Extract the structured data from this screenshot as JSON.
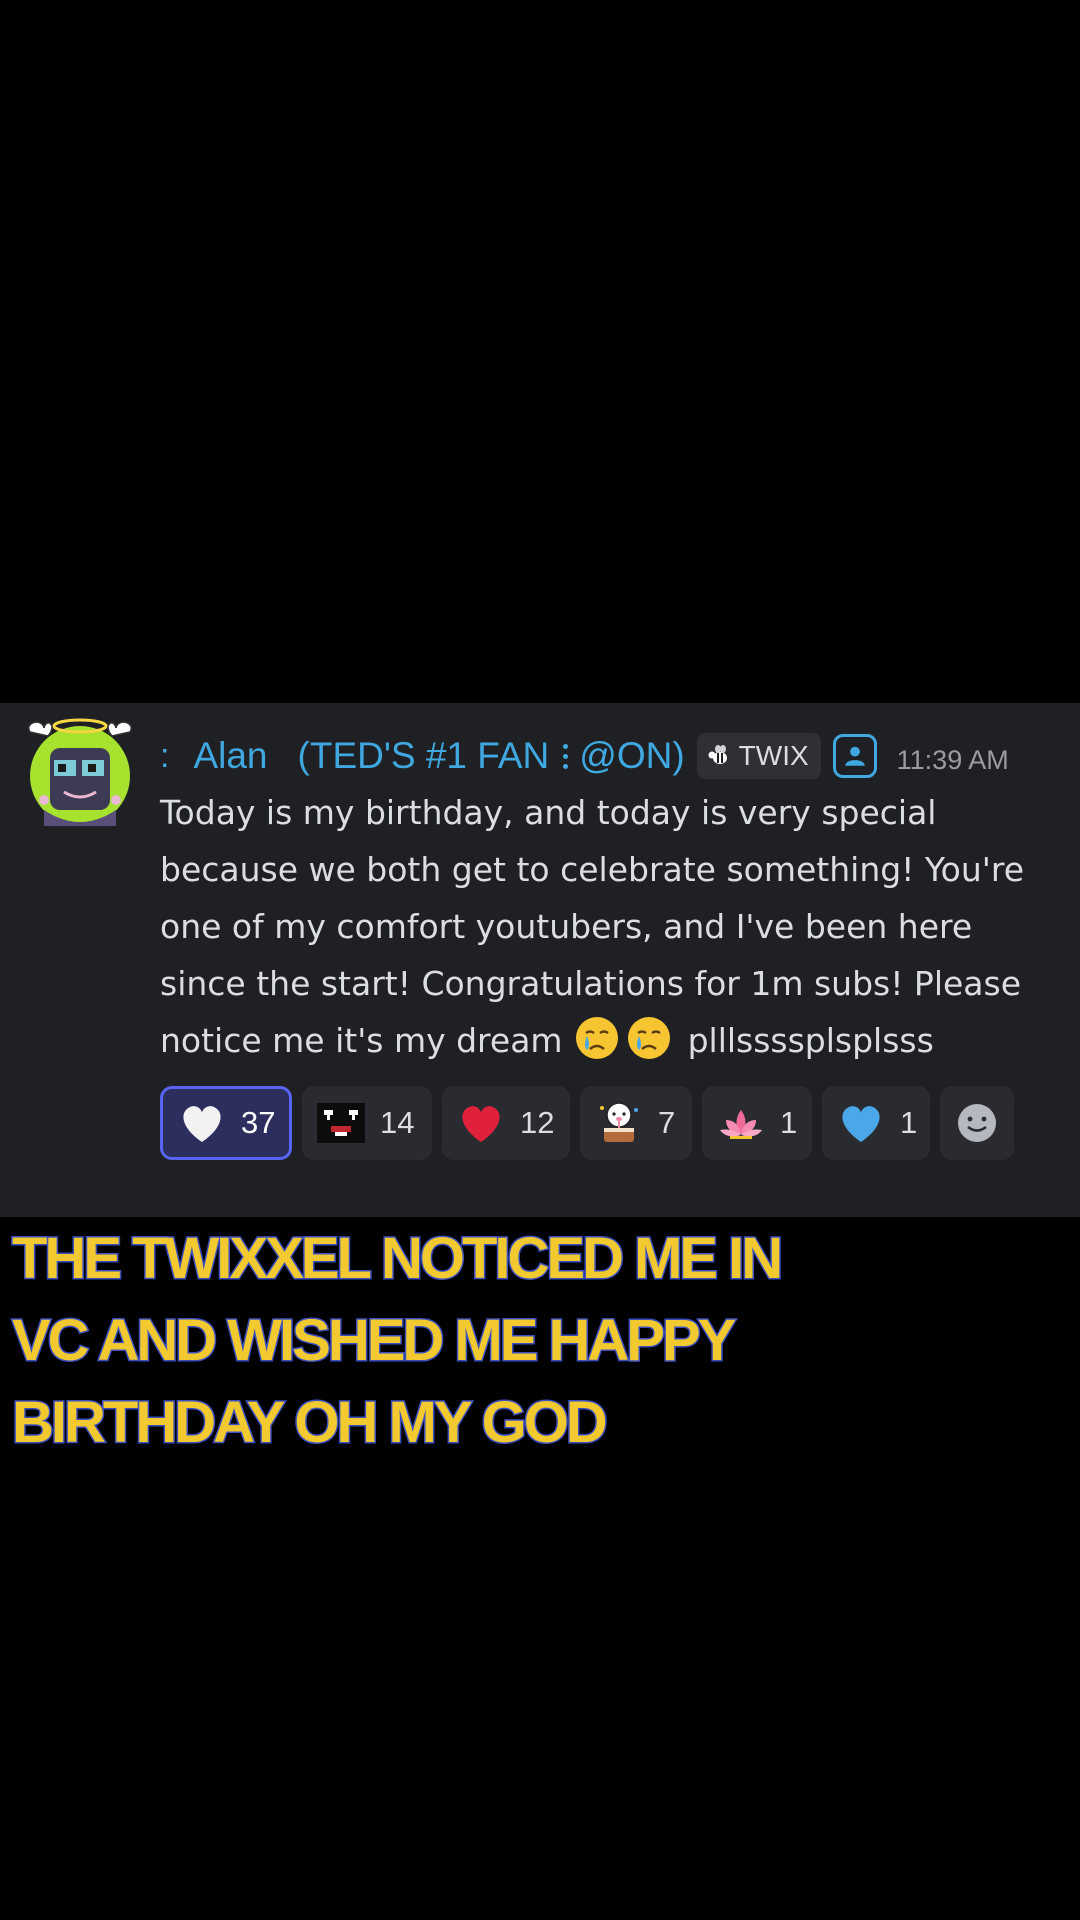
{
  "message": {
    "author": {
      "prefix": ":",
      "name": "Alan",
      "tag": "(TED'S #1 FAN",
      "tag2": "@ON)",
      "guild_tag": "TWIX",
      "name_color": "#3fa8e0"
    },
    "timestamp": "11:39 AM",
    "lines": [
      "Today is my birthday, and today is very special",
      "because we both get to celebrate something! You're",
      "one of my comfort youtubers, and I've been here",
      "since the start! Congratulations for 1m subs! Please"
    ],
    "last_line_prefix": "notice me it's my dream",
    "last_line_suffix": "plllssssplsplsss",
    "last_line_emojis": [
      "crying-face-emoji",
      "crying-face-emoji"
    ]
  },
  "reactions": [
    {
      "emoji": "white-heart",
      "count": "37",
      "active": true
    },
    {
      "emoji": "pixel-face",
      "count": "14",
      "active": false
    },
    {
      "emoji": "red-heart",
      "count": "12",
      "active": false
    },
    {
      "emoji": "birthday-cake-character",
      "count": "7",
      "active": false
    },
    {
      "emoji": "lotus",
      "count": "1",
      "active": false
    },
    {
      "emoji": "blue-heart",
      "count": "1",
      "active": false
    }
  ],
  "caption": {
    "lines": [
      "THE TWIXXEL NOTICED ME IN",
      "VC AND WISHED ME HAPPY",
      "BIRTHDAY OH MY GOD"
    ],
    "fill_color": "#f3c930",
    "stroke_color": "#3a4fbf"
  },
  "colors": {
    "panel_bg": "#1f2024",
    "reaction_bg": "#2a2b30",
    "reaction_active_bg": "#2c2f5e",
    "reaction_active_border": "#5865f2",
    "text": "#dbdee1",
    "timestamp": "#9a9ca4"
  }
}
